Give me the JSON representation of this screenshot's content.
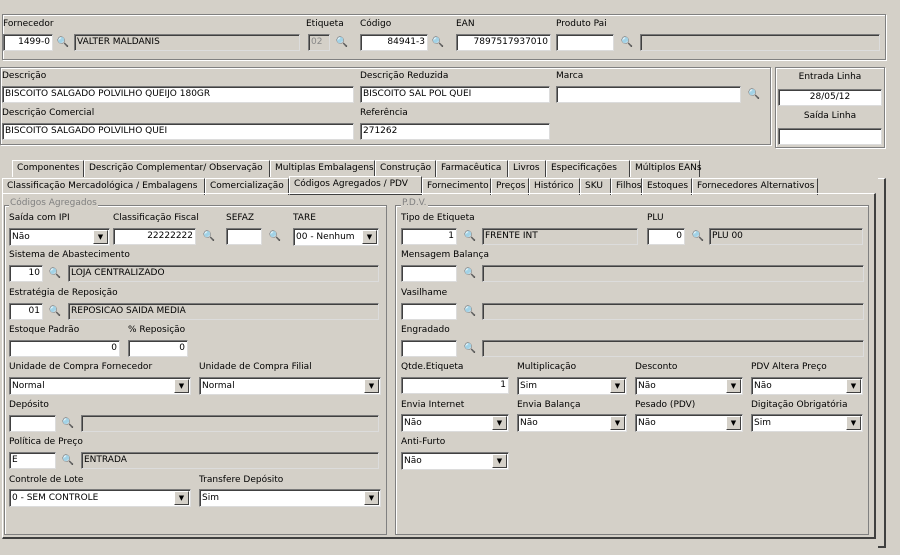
{
  "top": {
    "fornecedor_label": "Fornecedor",
    "fornecedor_code": "1499-0",
    "fornecedor_name": "VALTER MALDANIS",
    "etiqueta_label": "Etiqueta",
    "etiqueta_value": "02",
    "codigo_label": "Código",
    "codigo_value": "84941-3",
    "ean_label": "EAN",
    "ean_value": "7897517937010",
    "produto_pai_label": "Produto Pai",
    "produto_pai_value": "",
    "produto_pai_name": ""
  },
  "desc": {
    "descricao_label": "Descrição",
    "descricao_value": "BISCOITO SALGADO POLVILHO QUEIJO 180GR",
    "reduzida_label": "Descrição Reduzida",
    "reduzida_value": "BISCOITO SAL POL QUEI",
    "marca_label": "Marca",
    "marca_value": "",
    "comercial_label": "Descrição Comercial",
    "comercial_value": "BISCOITO SALGADO POLVILHO QUEI",
    "referencia_label": "Referência",
    "referencia_value": "271262"
  },
  "side": {
    "entrada_label": "Entrada Linha",
    "entrada_value": "28/05/12",
    "saida_label": "Saída Linha",
    "saida_value": ""
  },
  "tabs_row1": [
    "Componentes",
    "Descrição Complementar/ Observação",
    "Multiplas Embalagens",
    "Construção",
    "Farmacêutica",
    "Livros",
    "Especificações",
    "Múltiplos EANs"
  ],
  "tabs_row2": [
    "Classificação Mercadológica / Embalagens",
    "Comercialização",
    "Códigos Agregados / PDV",
    "Fornecimento",
    "Preços",
    "Histórico",
    "SKU",
    "Filhos",
    "Estoques",
    "Fornecedores Alternativos"
  ],
  "ca": {
    "title": "Códigos Agregados",
    "saida_ipi_label": "Saída com IPI",
    "saida_ipi_value": "Não",
    "class_fiscal_label": "Classificação Fiscal",
    "class_fiscal_value": "22222222",
    "sefaz_label": "SEFAZ",
    "sefaz_value": "",
    "tare_label": "TARE",
    "tare_value": "00 - Nenhum",
    "sist_label": "Sistema de Abastecimento",
    "sist_code": "10",
    "sist_name": "LOJA CENTRALIZADO",
    "estr_label": "Estratégia de Reposição",
    "estr_code": "01",
    "estr_name": "REPOSICAO SAIDA MEDIA",
    "estoque_label": "Estoque Padrão",
    "estoque_value": "0",
    "reposicao_label": "% Reposição",
    "reposicao_value": "0",
    "uc_forn_label": "Unidade de Compra Fornecedor",
    "uc_forn_value": "Normal",
    "uc_filial_label": "Unidade de Compra Filial",
    "uc_filial_value": "Normal",
    "deposito_label": "Depósito",
    "deposito_code": "",
    "deposito_name": "",
    "politica_label": "Política de Preço",
    "politica_code": "E",
    "politica_name": "ENTRADA",
    "lote_label": "Controle de Lote",
    "lote_value": "0 - SEM CONTROLE",
    "transf_label": "Transfere Depósito",
    "transf_value": "Sim"
  },
  "pdv": {
    "title": "P.D.V.",
    "tipo_label": "Tipo de Etiqueta",
    "tipo_code": "1",
    "tipo_name": "FRENTE INT",
    "plu_label": "PLU",
    "plu_code": "0",
    "plu_name": "PLU 00",
    "msg_label": "Mensagem Balança",
    "msg_code": "",
    "msg_name": "",
    "vas_label": "Vasilhame",
    "vas_code": "",
    "vas_name": "",
    "eng_label": "Engradado",
    "eng_code": "",
    "eng_name": "",
    "qtde_label": "Qtde.Etiqueta",
    "qtde_value": "1",
    "mult_label": "Multiplicação",
    "mult_value": "Sim",
    "desconto_label": "Desconto",
    "desconto_value": "Não",
    "pdv_altera_label": "PDV Altera Preço",
    "pdv_altera_value": "Não",
    "envia_internet_label": "Envia Internet",
    "envia_internet_value": "Não",
    "envia_balanca_label": "Envia Balança",
    "envia_balanca_value": "Não",
    "pesado_label": "Pesado (PDV)",
    "pesado_value": "Não",
    "digitacao_label": "Digitação Obrigatória",
    "digitacao_value": "Sim",
    "antifurto_label": "Anti-Furto",
    "antifurto_value": "Não"
  },
  "icons": {
    "search": "binoculars-icon",
    "dropdown": "chevron-down-icon"
  }
}
